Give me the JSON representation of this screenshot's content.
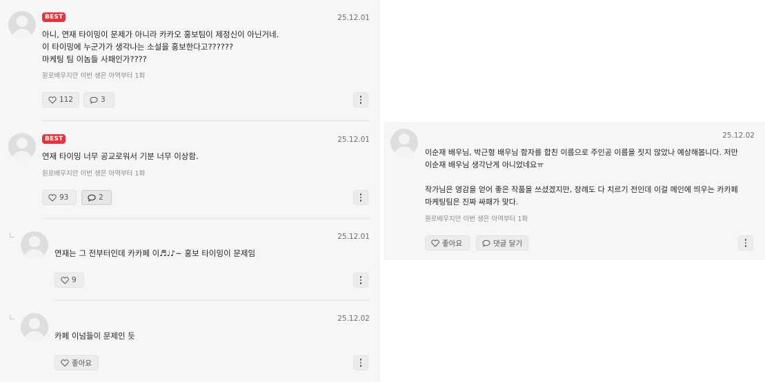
{
  "comments": [
    {
      "badge": "BEST",
      "date": "25.12.01",
      "lines": [
        "아니, 연재 타이밍이 문제가 아니라 카카오 홍보팀이 제정신이 아닌거네.",
        "이 타이밍에 누군가가 생각나는 소설을 홍보한다고??????",
        "마케팅 팀 이놈들 사패인가????"
      ],
      "meta": "원로배우지만 이번 생은 아역부터 1화",
      "likes": "112",
      "replies": "3"
    },
    {
      "badge": "BEST",
      "date": "25.12.01",
      "lines": [
        "연재 타이밍 너무 공교로워서 기분 너무 이상함."
      ],
      "meta": "원로배우지만 이번 생은 아역부터 1화",
      "likes": "93",
      "replies": "2"
    }
  ],
  "replies": [
    {
      "date": "25.12.01",
      "text": "연재는 그 전부터인데 카카페 이♬♩♪~ 홍보 타이밍이 문제임",
      "likes": "9"
    },
    {
      "date": "25.12.02",
      "text": "카페 이넘들이 문제인 듯",
      "like_label": "좋아요"
    }
  ],
  "right_comment": {
    "date": "25.12.02",
    "lines": [
      "이순재 배우님, 박근형 배우님 함자를 합친 이름으로 주인공 이름을 짓지 않았나 예상해봅니다. 저만",
      "이순재 배우님 생각난게 아니었네요ㅠ",
      "",
      "작가님은 영감을 얻어 좋은 작품을 쓰셨겠지만, 장례도 다 치르기 전인데 이걸 메인에 띄우는 카카페",
      "마케팅팀은 진짜 싸패가 맞다."
    ],
    "meta": "원로배우지만 이번 생은 아역부터 1화",
    "like_label": "좋아요",
    "reply_label": "댓글 달기"
  },
  "colors": {
    "badge": "#e0363f",
    "panel": "#f6f6f6"
  },
  "icons": [
    "user-avatar-icon",
    "heart-icon",
    "speech-bubble-icon",
    "more-vertical-icon",
    "reply-arrow-icon"
  ]
}
